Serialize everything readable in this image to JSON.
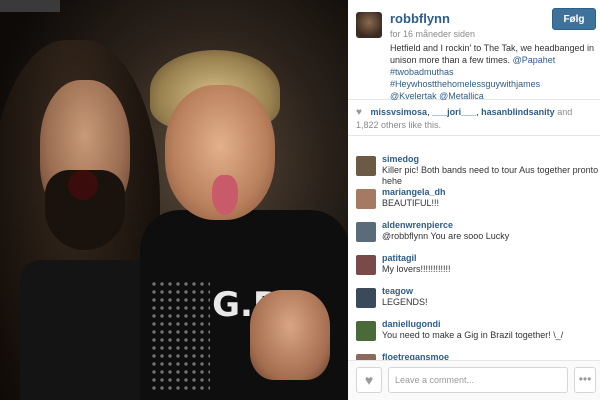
{
  "post": {
    "owner": "robbflynn",
    "timestamp": "for 16 måneder siden",
    "follow_label": "Følg",
    "caption_text": "Hetfield and I rockin' to The Tak, we headbanged in unison more than a few times. ",
    "caption_mention1": "@Papahet",
    "caption_hashtags": "#twobadmuthas #Heywhostthehomelessguywithjames",
    "caption_mention2": "@Kvelertak @Metallica"
  },
  "likes": {
    "likers": [
      "missvsimosa",
      "___jori___",
      "hasanbIindsanity"
    ],
    "count_text": "and 1,822 others like this."
  },
  "comments": [
    {
      "user": "simedog",
      "text": "Killer pic! Both bands need to tour Aus together pronto hehe",
      "avatar_color": "#6b5a44"
    },
    {
      "user": "mariangela_dh",
      "text": "BEAUTIFUL!!!",
      "avatar_color": "#a57a62"
    },
    {
      "user": "aldenwrenpierce",
      "text": "@robbflynn You are sooo Lucky",
      "avatar_color": "#5a6b7a"
    },
    {
      "user": "patitagil",
      "text": "My lovers!!!!!!!!!!!!",
      "avatar_color": "#7a4a4a"
    },
    {
      "user": "teagow",
      "text": "LEGENDS!",
      "avatar_color": "#3a4a5a"
    },
    {
      "user": "daniellugondi",
      "text": "You need to make a Gig in Brazil together!  \\_/",
      "avatar_color": "#4a6a3a"
    },
    {
      "user": "floetregansmoe",
      "text": "",
      "avatar_color": "#8a6a5a"
    }
  ],
  "footer": {
    "like_icon": "heart-icon",
    "comment_placeholder": "Leave a comment...",
    "more_icon": "more-icon",
    "more_glyph": "•••",
    "heart_glyph": "♥"
  },
  "photo": {
    "shirt_print": "G.P"
  }
}
